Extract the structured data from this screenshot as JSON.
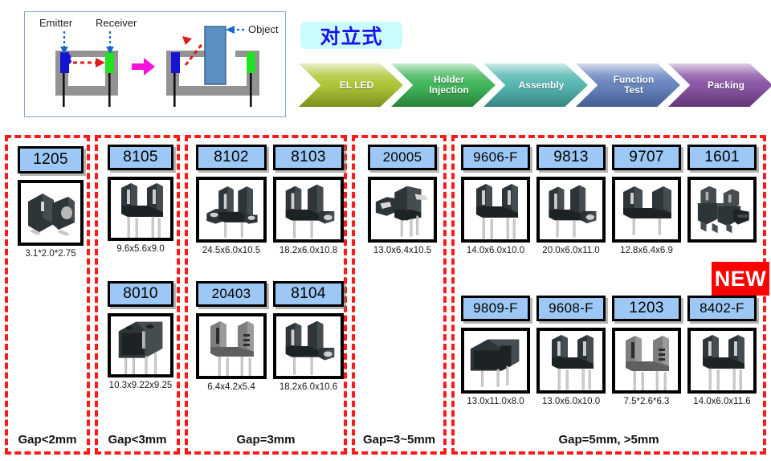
{
  "schematic": {
    "labels": {
      "emitter": "Emitter",
      "receiver": "Receiver",
      "object": "Object"
    }
  },
  "title_chip": {
    "text": "对立式"
  },
  "process_flow": {
    "steps": [
      {
        "label": "EL LED",
        "color": "#b0c53a",
        "color_dark": "#8fa521"
      },
      {
        "label": "Holder\nInjection",
        "color": "#43b65c",
        "color_dark": "#2c9544"
      },
      {
        "label": "Assembly",
        "color": "#57b7b0",
        "color_dark": "#3d9a95"
      },
      {
        "label": "Function\nTest",
        "color": "#6a86bf",
        "color_dark": "#4e6aa6"
      },
      {
        "label": "Packing",
        "color": "#8c58a6",
        "color_dark": "#6f3f88"
      }
    ]
  },
  "new_badge": {
    "text": "NEW",
    "color": "#fe0000"
  },
  "groups": [
    {
      "gap_label": "Gap<2mm",
      "products": [
        {
          "code": "1205",
          "dim": "3.1*2.0*2.75",
          "style": "smd"
        }
      ]
    },
    {
      "gap_label": "Gap<3mm",
      "products": [
        {
          "code": "8105",
          "dim": "9.6x5.6x9.0",
          "style": "u-slot"
        },
        {
          "code": "8010",
          "dim": "10.3x9.22x9.25",
          "style": "block4"
        }
      ]
    },
    {
      "gap_label": "Gap=3mm",
      "products": [
        {
          "code": "8102",
          "dim": "24.5x6.0x10.5",
          "style": "flange-l"
        },
        {
          "code": "8103",
          "dim": "18.2x6.0x10.8",
          "style": "flange-r"
        },
        {
          "code": "20403",
          "dim": "6.4x4.2x5.4",
          "style": "u-grey"
        },
        {
          "code": "8104",
          "dim": "18.2x6.0x10.6",
          "style": "flange-r"
        }
      ]
    },
    {
      "gap_label": "Gap=3~5mm",
      "products": [
        {
          "code": "20005",
          "dim": "13.0x6.4x10.5",
          "style": "wing"
        }
      ]
    },
    {
      "gap_label": "Gap=5mm, >5mm",
      "products": [
        {
          "code": "9606-F",
          "dim": "14.0x6.0x10.0",
          "style": "u-slot"
        },
        {
          "code": "9813",
          "dim": "20.0x6.0x11.0",
          "style": "flange-r"
        },
        {
          "code": "9707",
          "dim": "12.8x6.4x6.9",
          "style": "u-wide"
        },
        {
          "code": "1601",
          "dim": "",
          "style": "multi"
        },
        {
          "code": "9809-F",
          "dim": "13.0x11.0x8.0",
          "style": "solid"
        },
        {
          "code": "9608-F",
          "dim": "13.0x6.0x10.0",
          "style": "u-slot"
        },
        {
          "code": "1203",
          "dim": "7.5*2.6*6.3",
          "style": "u-grey"
        },
        {
          "code": "8402-F",
          "dim": "14.0x6.0x11.6",
          "style": "u-slot"
        }
      ]
    }
  ]
}
